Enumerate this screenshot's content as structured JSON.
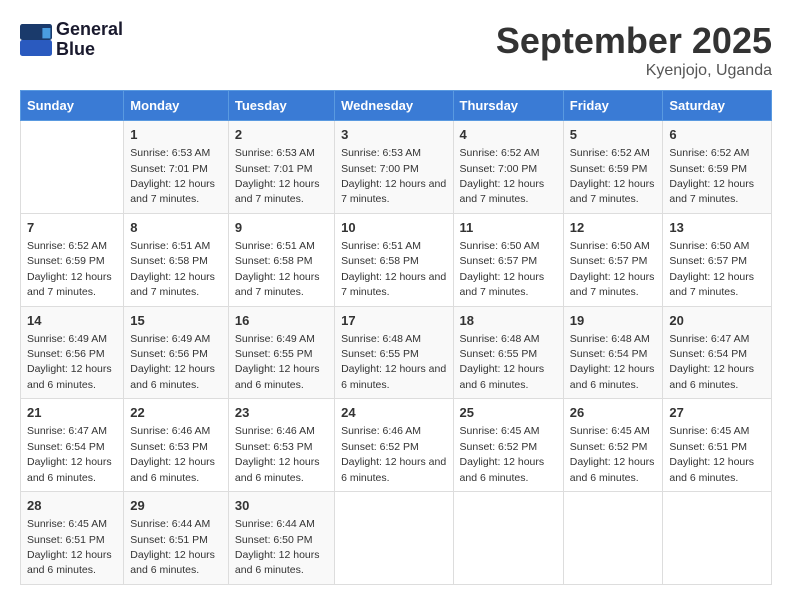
{
  "logo": {
    "line1": "General",
    "line2": "Blue"
  },
  "title": "September 2025",
  "location": "Kyenjojo, Uganda",
  "days_header": [
    "Sunday",
    "Monday",
    "Tuesday",
    "Wednesday",
    "Thursday",
    "Friday",
    "Saturday"
  ],
  "weeks": [
    [
      {
        "day": "",
        "sunrise": "",
        "sunset": "",
        "daylight": ""
      },
      {
        "day": "1",
        "sunrise": "Sunrise: 6:53 AM",
        "sunset": "Sunset: 7:01 PM",
        "daylight": "Daylight: 12 hours and 7 minutes."
      },
      {
        "day": "2",
        "sunrise": "Sunrise: 6:53 AM",
        "sunset": "Sunset: 7:01 PM",
        "daylight": "Daylight: 12 hours and 7 minutes."
      },
      {
        "day": "3",
        "sunrise": "Sunrise: 6:53 AM",
        "sunset": "Sunset: 7:00 PM",
        "daylight": "Daylight: 12 hours and 7 minutes."
      },
      {
        "day": "4",
        "sunrise": "Sunrise: 6:52 AM",
        "sunset": "Sunset: 7:00 PM",
        "daylight": "Daylight: 12 hours and 7 minutes."
      },
      {
        "day": "5",
        "sunrise": "Sunrise: 6:52 AM",
        "sunset": "Sunset: 6:59 PM",
        "daylight": "Daylight: 12 hours and 7 minutes."
      },
      {
        "day": "6",
        "sunrise": "Sunrise: 6:52 AM",
        "sunset": "Sunset: 6:59 PM",
        "daylight": "Daylight: 12 hours and 7 minutes."
      }
    ],
    [
      {
        "day": "7",
        "sunrise": "Sunrise: 6:52 AM",
        "sunset": "Sunset: 6:59 PM",
        "daylight": "Daylight: 12 hours and 7 minutes."
      },
      {
        "day": "8",
        "sunrise": "Sunrise: 6:51 AM",
        "sunset": "Sunset: 6:58 PM",
        "daylight": "Daylight: 12 hours and 7 minutes."
      },
      {
        "day": "9",
        "sunrise": "Sunrise: 6:51 AM",
        "sunset": "Sunset: 6:58 PM",
        "daylight": "Daylight: 12 hours and 7 minutes."
      },
      {
        "day": "10",
        "sunrise": "Sunrise: 6:51 AM",
        "sunset": "Sunset: 6:58 PM",
        "daylight": "Daylight: 12 hours and 7 minutes."
      },
      {
        "day": "11",
        "sunrise": "Sunrise: 6:50 AM",
        "sunset": "Sunset: 6:57 PM",
        "daylight": "Daylight: 12 hours and 7 minutes."
      },
      {
        "day": "12",
        "sunrise": "Sunrise: 6:50 AM",
        "sunset": "Sunset: 6:57 PM",
        "daylight": "Daylight: 12 hours and 7 minutes."
      },
      {
        "day": "13",
        "sunrise": "Sunrise: 6:50 AM",
        "sunset": "Sunset: 6:57 PM",
        "daylight": "Daylight: 12 hours and 7 minutes."
      }
    ],
    [
      {
        "day": "14",
        "sunrise": "Sunrise: 6:49 AM",
        "sunset": "Sunset: 6:56 PM",
        "daylight": "Daylight: 12 hours and 6 minutes."
      },
      {
        "day": "15",
        "sunrise": "Sunrise: 6:49 AM",
        "sunset": "Sunset: 6:56 PM",
        "daylight": "Daylight: 12 hours and 6 minutes."
      },
      {
        "day": "16",
        "sunrise": "Sunrise: 6:49 AM",
        "sunset": "Sunset: 6:55 PM",
        "daylight": "Daylight: 12 hours and 6 minutes."
      },
      {
        "day": "17",
        "sunrise": "Sunrise: 6:48 AM",
        "sunset": "Sunset: 6:55 PM",
        "daylight": "Daylight: 12 hours and 6 minutes."
      },
      {
        "day": "18",
        "sunrise": "Sunrise: 6:48 AM",
        "sunset": "Sunset: 6:55 PM",
        "daylight": "Daylight: 12 hours and 6 minutes."
      },
      {
        "day": "19",
        "sunrise": "Sunrise: 6:48 AM",
        "sunset": "Sunset: 6:54 PM",
        "daylight": "Daylight: 12 hours and 6 minutes."
      },
      {
        "day": "20",
        "sunrise": "Sunrise: 6:47 AM",
        "sunset": "Sunset: 6:54 PM",
        "daylight": "Daylight: 12 hours and 6 minutes."
      }
    ],
    [
      {
        "day": "21",
        "sunrise": "Sunrise: 6:47 AM",
        "sunset": "Sunset: 6:54 PM",
        "daylight": "Daylight: 12 hours and 6 minutes."
      },
      {
        "day": "22",
        "sunrise": "Sunrise: 6:46 AM",
        "sunset": "Sunset: 6:53 PM",
        "daylight": "Daylight: 12 hours and 6 minutes."
      },
      {
        "day": "23",
        "sunrise": "Sunrise: 6:46 AM",
        "sunset": "Sunset: 6:53 PM",
        "daylight": "Daylight: 12 hours and 6 minutes."
      },
      {
        "day": "24",
        "sunrise": "Sunrise: 6:46 AM",
        "sunset": "Sunset: 6:52 PM",
        "daylight": "Daylight: 12 hours and 6 minutes."
      },
      {
        "day": "25",
        "sunrise": "Sunrise: 6:45 AM",
        "sunset": "Sunset: 6:52 PM",
        "daylight": "Daylight: 12 hours and 6 minutes."
      },
      {
        "day": "26",
        "sunrise": "Sunrise: 6:45 AM",
        "sunset": "Sunset: 6:52 PM",
        "daylight": "Daylight: 12 hours and 6 minutes."
      },
      {
        "day": "27",
        "sunrise": "Sunrise: 6:45 AM",
        "sunset": "Sunset: 6:51 PM",
        "daylight": "Daylight: 12 hours and 6 minutes."
      }
    ],
    [
      {
        "day": "28",
        "sunrise": "Sunrise: 6:45 AM",
        "sunset": "Sunset: 6:51 PM",
        "daylight": "Daylight: 12 hours and 6 minutes."
      },
      {
        "day": "29",
        "sunrise": "Sunrise: 6:44 AM",
        "sunset": "Sunset: 6:51 PM",
        "daylight": "Daylight: 12 hours and 6 minutes."
      },
      {
        "day": "30",
        "sunrise": "Sunrise: 6:44 AM",
        "sunset": "Sunset: 6:50 PM",
        "daylight": "Daylight: 12 hours and 6 minutes."
      },
      {
        "day": "",
        "sunrise": "",
        "sunset": "",
        "daylight": ""
      },
      {
        "day": "",
        "sunrise": "",
        "sunset": "",
        "daylight": ""
      },
      {
        "day": "",
        "sunrise": "",
        "sunset": "",
        "daylight": ""
      },
      {
        "day": "",
        "sunrise": "",
        "sunset": "",
        "daylight": ""
      }
    ]
  ]
}
